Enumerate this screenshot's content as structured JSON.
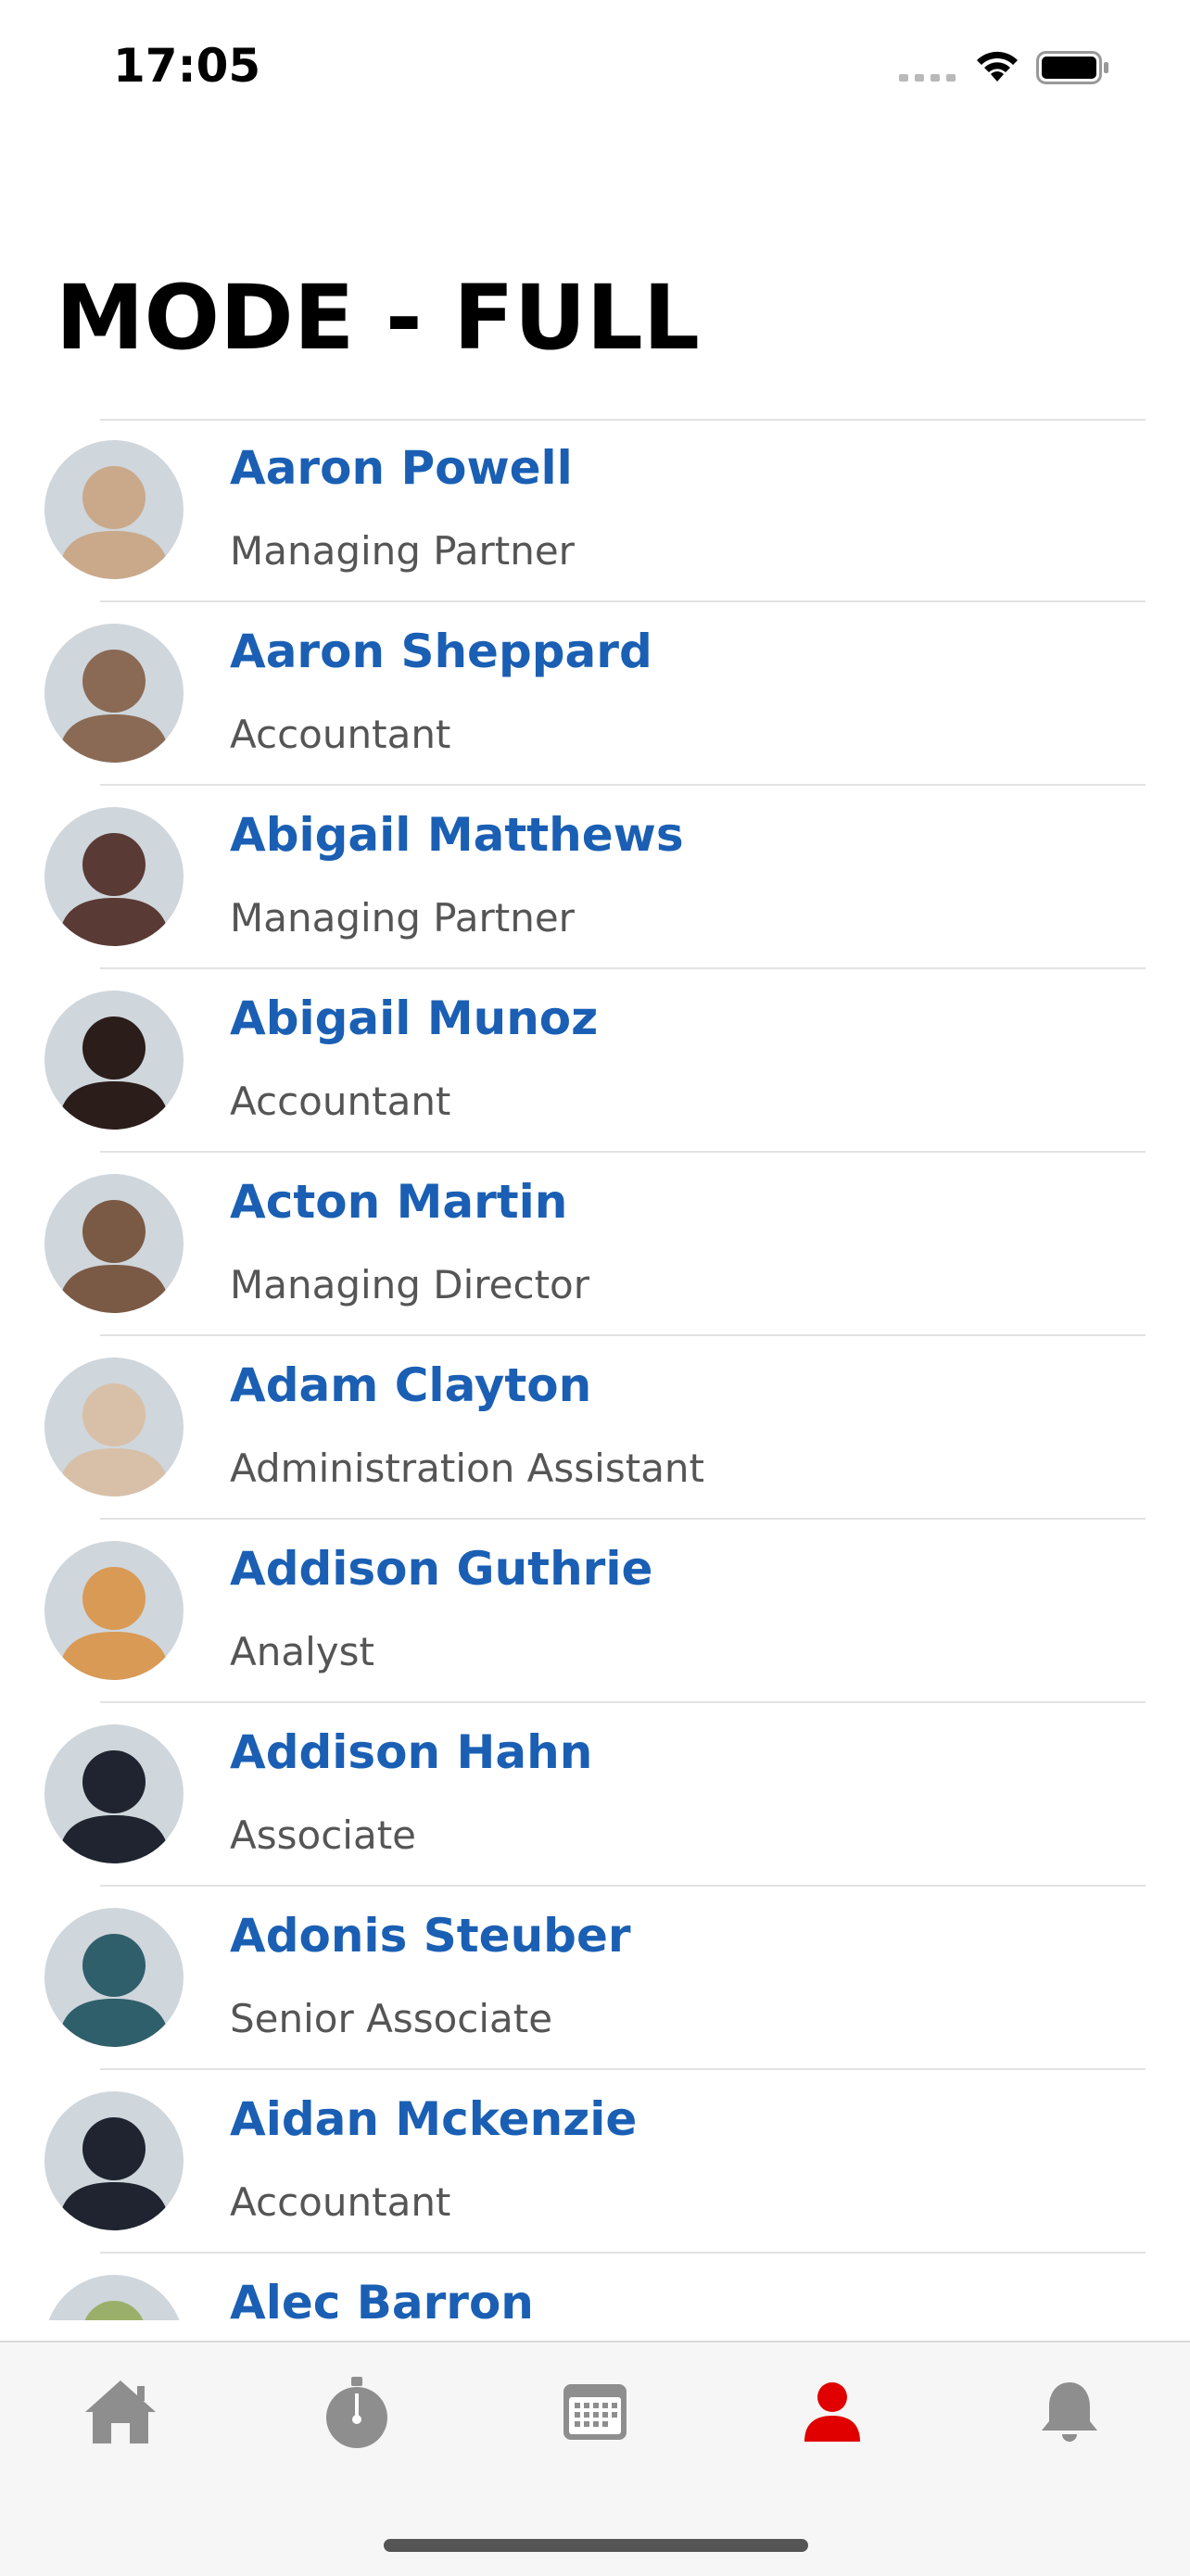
{
  "status_bar": {
    "time": "17:05",
    "icons": [
      "cellular-signal-icon",
      "wifi-icon",
      "battery-icon"
    ]
  },
  "page": {
    "title": "MODE - FULL"
  },
  "contacts": [
    {
      "name": "Aaron Powell",
      "role": "Managing Partner",
      "avatar_color": "#c9a98a"
    },
    {
      "name": "Aaron Sheppard",
      "role": "Accountant",
      "avatar_color": "#8a6a55"
    },
    {
      "name": "Abigail Matthews",
      "role": "Managing Partner",
      "avatar_color": "#5a3a35"
    },
    {
      "name": "Abigail Munoz",
      "role": "Accountant",
      "avatar_color": "#2b1d1a"
    },
    {
      "name": "Acton Martin",
      "role": "Managing Director",
      "avatar_color": "#7a5a45"
    },
    {
      "name": "Adam Clayton",
      "role": "Administration Assistant",
      "avatar_color": "#d8c0a8"
    },
    {
      "name": "Addison Guthrie",
      "role": "Analyst",
      "avatar_color": "#d89a55"
    },
    {
      "name": "Addison Hahn",
      "role": "Associate",
      "avatar_color": "#1f2430"
    },
    {
      "name": "Adonis Steuber",
      "role": "Senior Associate",
      "avatar_color": "#2f5f6a"
    },
    {
      "name": "Aidan Mckenzie",
      "role": "Accountant",
      "avatar_color": "#1f2430"
    },
    {
      "name": "Alec Barron",
      "role": "",
      "avatar_color": "#9ab06a"
    }
  ],
  "tab_bar": {
    "tabs": [
      {
        "icon": "home-icon",
        "active": false
      },
      {
        "icon": "stopwatch-icon",
        "active": false
      },
      {
        "icon": "calendar-icon",
        "active": false
      },
      {
        "icon": "person-icon",
        "active": true
      },
      {
        "icon": "bell-icon",
        "active": false
      }
    ],
    "active_color": "#e00000",
    "inactive_color": "#8e8e8e"
  },
  "colors": {
    "name_link": "#1a5fb4",
    "role_text": "#555555",
    "divider": "#e2e2e2"
  }
}
